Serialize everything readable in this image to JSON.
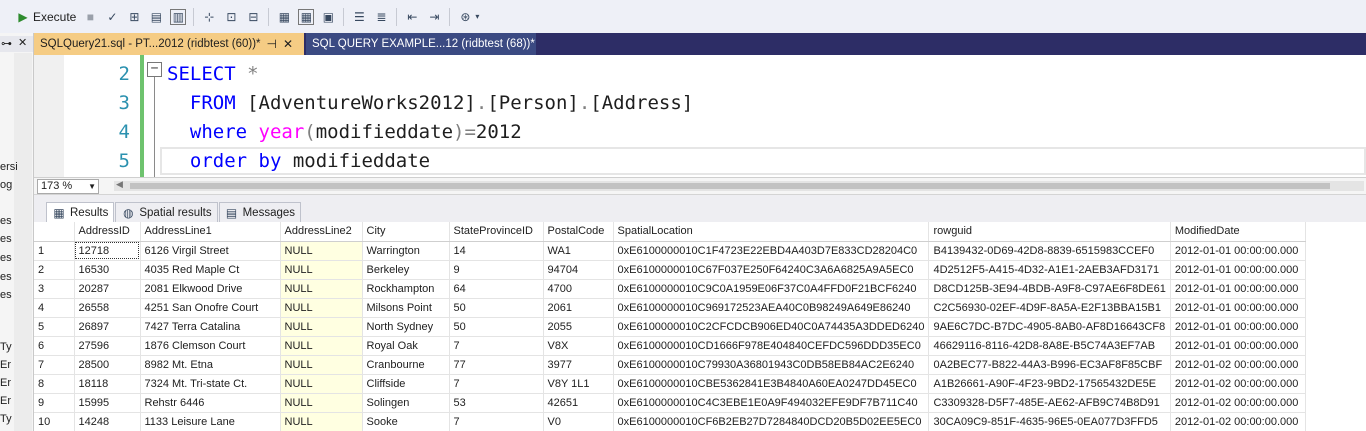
{
  "toolbar": {
    "execute_label": "Execute"
  },
  "left_panel": {
    "labels": [
      "ersi",
      "og",
      "es",
      "es",
      "es",
      "es",
      "es",
      "Ty",
      "Er",
      "Er",
      "Er",
      "Ty"
    ]
  },
  "tabs": [
    {
      "label": "SQLQuery21.sql - PT...2012 (ridbtest (60))*",
      "close": "✕",
      "pin": "⊣"
    },
    {
      "label": "SQL QUERY EXAMPLE...12 (ridbtest (68))*"
    }
  ],
  "editor": {
    "lines": [
      {
        "num": "2",
        "parts": [
          {
            "t": "SELECT",
            "c": "kw"
          },
          {
            "t": " *",
            "c": "gray"
          }
        ]
      },
      {
        "num": "3",
        "parts": [
          {
            "t": "  FROM ",
            "c": "kw"
          },
          {
            "t": "[AdventureWorks2012]",
            "c": "plain"
          },
          {
            "t": ".",
            "c": "gray"
          },
          {
            "t": "[Person]",
            "c": "plain"
          },
          {
            "t": ".",
            "c": "gray"
          },
          {
            "t": "[Address]",
            "c": "plain"
          }
        ]
      },
      {
        "num": "4",
        "parts": [
          {
            "t": "  where ",
            "c": "kw"
          },
          {
            "t": "year",
            "c": "fn"
          },
          {
            "t": "(",
            "c": "gray"
          },
          {
            "t": "modifieddate",
            "c": "plain"
          },
          {
            "t": ")=",
            "c": "gray"
          },
          {
            "t": "2012",
            "c": "plain"
          }
        ]
      },
      {
        "num": "5",
        "parts": [
          {
            "t": "  order by ",
            "c": "kw"
          },
          {
            "t": "modifieddate",
            "c": "plain"
          }
        ]
      }
    ],
    "fold_symbol": "−"
  },
  "zoom": {
    "value": "173 %"
  },
  "result_tabs": [
    {
      "label": "Results",
      "icon": "grid-icon"
    },
    {
      "label": "Spatial results",
      "icon": "globe-icon"
    },
    {
      "label": "Messages",
      "icon": "messages-icon"
    }
  ],
  "grid": {
    "columns": [
      "AddressID",
      "AddressLine1",
      "AddressLine2",
      "City",
      "StateProvinceID",
      "PostalCode",
      "SpatialLocation",
      "rowguid",
      "ModifiedDate"
    ],
    "rows": [
      [
        "1",
        "12718",
        "6126 Virgil Street",
        "NULL",
        "Warrington",
        "14",
        "WA1",
        "0xE6100000010C1F4723E22EBD4A403D7E833CD28204C0",
        "B4139432-0D69-42D8-8839-6515983CCEF0",
        "2012-01-01 00:00:00.000"
      ],
      [
        "2",
        "16530",
        "4035 Red Maple Ct",
        "NULL",
        "Berkeley",
        "9",
        "94704",
        "0xE6100000010C67F037E250F64240C3A6A6825A9A5EC0",
        "4D2512F5-A415-4D32-A1E1-2AEB3AFD3171",
        "2012-01-01 00:00:00.000"
      ],
      [
        "3",
        "20287",
        "2081 Elkwood Drive",
        "NULL",
        "Rockhampton",
        "64",
        "4700",
        "0xE6100000010C9C0A1959E06F37C0A4FFD0F21BCF6240",
        "D8CD125B-3E94-4BDB-A9F8-C97AE6F8DE61",
        "2012-01-01 00:00:00.000"
      ],
      [
        "4",
        "26558",
        "4251 San Onofre Court",
        "NULL",
        "Milsons Point",
        "50",
        "2061",
        "0xE6100000010C969172523AEA40C0B98249A649E86240",
        "C2C56930-02EF-4D9F-8A5A-E2F13BBA15B1",
        "2012-01-01 00:00:00.000"
      ],
      [
        "5",
        "26897",
        "7427 Terra Catalina",
        "NULL",
        "North Sydney",
        "50",
        "2055",
        "0xE6100000010C2CFCDCB906ED40C0A74435A3DDED6240",
        "9AE6C7DC-B7DC-4905-8AB0-AF8D16643CF8",
        "2012-01-01 00:00:00.000"
      ],
      [
        "6",
        "27596",
        "1876 Clemson Court",
        "NULL",
        "Royal Oak",
        "7",
        "V8X",
        "0xE6100000010CD1666F978E404840CEFDC596DDD35EC0",
        "46629116-8116-42D8-8A8E-B5C74A3EF7AB",
        "2012-01-01 00:00:00.000"
      ],
      [
        "7",
        "28500",
        "8982 Mt. Etna",
        "NULL",
        "Cranbourne",
        "77",
        "3977",
        "0xE6100000010C79930A36801943C0DB58EB84AC2E6240",
        "0A2BEC77-B822-44A3-B996-EC3AF8F85CBF",
        "2012-01-02 00:00:00.000"
      ],
      [
        "8",
        "18118",
        "7324 Mt. Tri-state Ct.",
        "NULL",
        "Cliffside",
        "7",
        "V8Y 1L1",
        "0xE6100000010CBE5362841E3B4840A60EA0247DD45EC0",
        "A1B26661-A90F-4F23-9BD2-17565432DE5E",
        "2012-01-02 00:00:00.000"
      ],
      [
        "9",
        "15995",
        "Rehstr 6446",
        "NULL",
        "Solingen",
        "53",
        "42651",
        "0xE6100000010C4C3EBE1E0A9F494032EFE9DF7B711C40",
        "C3309328-D5F7-485E-AE62-AFB9C74B8D91",
        "2012-01-02 00:00:00.000"
      ],
      [
        "10",
        "14248",
        "1133 Leisure Lane",
        "NULL",
        "Sooke",
        "7",
        "V0",
        "0xE6100000010CF6B2EB27D7284840DCD20B5D02EE5EC0",
        "30CA09C9-851F-4635-96E5-0EA077D3FFD5",
        "2012-01-02 00:00:00.000"
      ]
    ]
  }
}
